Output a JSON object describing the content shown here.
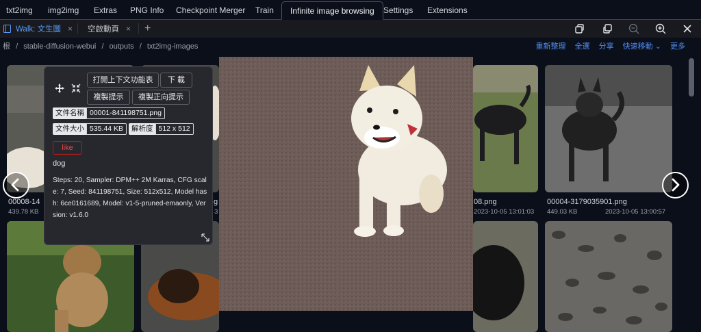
{
  "top_tabs": [
    "txt2img",
    "img2img",
    "Extras",
    "PNG Info",
    "Checkpoint Merger",
    "Train",
    "Infinite image browsing",
    "Settings",
    "Extensions"
  ],
  "active_top_tab": "Infinite image browsing",
  "file_tabs": [
    {
      "label": "Walk: 文生圖",
      "close": "×"
    },
    {
      "label": "空啟動頁",
      "close": "×"
    }
  ],
  "add_tab": "+",
  "window_icons": [
    "tile-icon",
    "restore-icon",
    "zoom-out-icon",
    "zoom-in-icon",
    "close-icon"
  ],
  "breadcrumb": [
    "根",
    "/",
    "stable-diffusion-webui",
    "/",
    "outputs",
    "/",
    "txt2img-images"
  ],
  "actions": [
    "重新整理",
    "全選",
    "分享",
    "快速移動 ⌄",
    "更多"
  ],
  "grid": [
    {
      "name": "00008-14",
      "size": "439.78 KB",
      "date": ""
    },
    {
      "name": "",
      "size": "",
      "date": ""
    },
    {
      "name": "",
      "size": "",
      "date": ""
    },
    {
      "name": "08.png",
      "size": "",
      "date": "2023-10-05 13:01:03"
    },
    {
      "name": "00004-3179035901.png",
      "size": "449.03 KB",
      "date": "2023-10-05 13:00:57"
    }
  ],
  "partial_labels": {
    "col2": "g",
    "col2_sub": "3"
  },
  "panel": {
    "btn_context": "打開上下文功能表",
    "btn_download": "下 載",
    "btn_copy_prompt": "複製提示",
    "btn_copy_pos": "複製正向提示",
    "filename_key": "文件名稱",
    "filename_val": "00001-841198751.png",
    "filesize_key": "文件大小",
    "filesize_val": "535.44 KB",
    "res_key": "解析度",
    "res_val": "512 x 512",
    "like": "like",
    "prompt": "dog",
    "params": "Steps: 20, Sampler: DPM++ 2M Karras, CFG scale: 7, Seed: 841198751, Size: 512x512, Model hash: 6ce0161689, Model: v1-5-pruned-emaonly, Version: v1.6.0"
  },
  "colors": {
    "accent": "#5a9cf8",
    "like": "#ef4444",
    "bg": "#0b0f19"
  }
}
